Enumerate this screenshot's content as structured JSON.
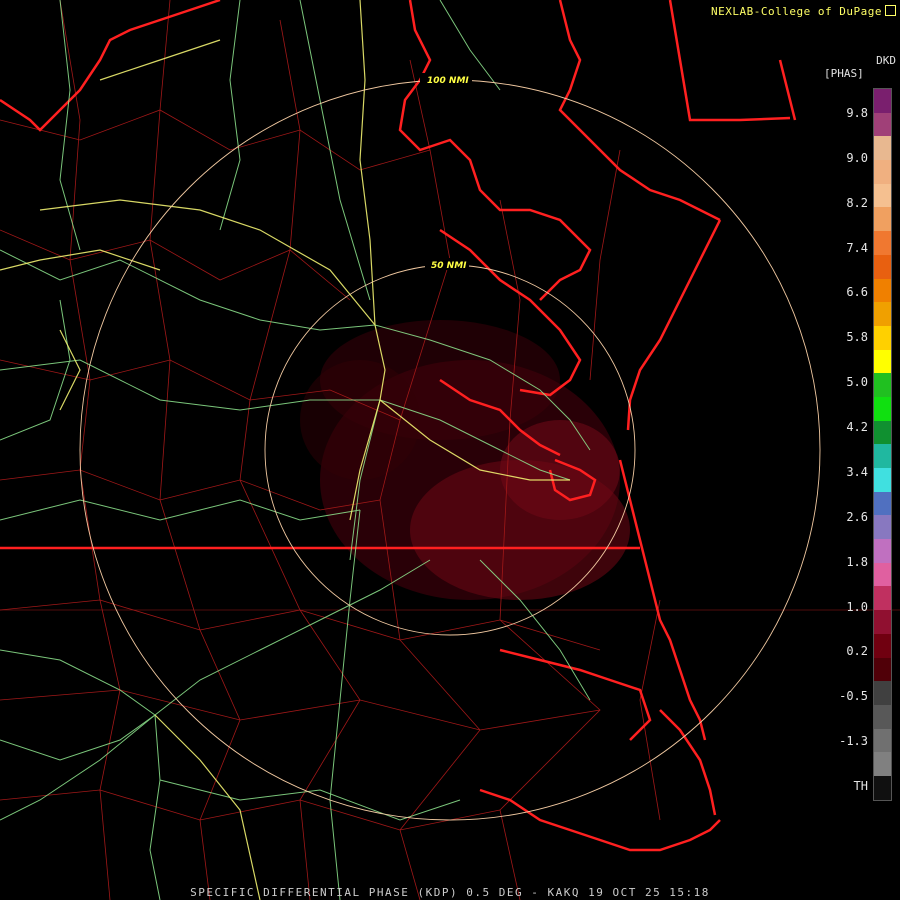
{
  "header": {
    "credit": "NEXLAB-College of DuPage"
  },
  "legend": {
    "units_line1": "DKD",
    "units_line2": "[PHAS]",
    "ticks": [
      "9.8",
      "9.0",
      "8.2",
      "7.4",
      "6.6",
      "5.8",
      "5.0",
      "4.2",
      "3.4",
      "2.6",
      "1.8",
      "1.0",
      "0.2",
      "-0.5",
      "-1.3",
      "TH"
    ],
    "colors": [
      "#7a1f6e",
      "#a04078",
      "#e8b890",
      "#f0b080",
      "#f5c090",
      "#f0a060",
      "#f07830",
      "#e86010",
      "#f08000",
      "#f0a000",
      "#ffd000",
      "#ffff00",
      "#20c020",
      "#10e010",
      "#109030",
      "#20b8a0",
      "#40e0e0",
      "#5070c0",
      "#8878c0",
      "#c070c0",
      "#e060a0",
      "#c03060",
      "#901030",
      "#700010",
      "#500008",
      "#404040",
      "#585858",
      "#707070",
      "#808080",
      "#101010"
    ]
  },
  "map": {
    "range_rings": [
      {
        "label": "50 NMI"
      },
      {
        "label": "100 NMI"
      }
    ]
  },
  "footer": {
    "caption": "SPECIFIC DIFFERENTIAL PHASE (KDP) 0.5 DEG - KAKQ 19 OCT 25 15:18"
  },
  "icons": {
    "credit_link": "external-link-icon"
  },
  "colors": {
    "state_border": "#ff2020",
    "county_border": "#a01818",
    "highway_green": "#90e890",
    "highway_yellow": "#f0f070",
    "ring": "#f0c8a0",
    "echo": "#7a0010"
  }
}
